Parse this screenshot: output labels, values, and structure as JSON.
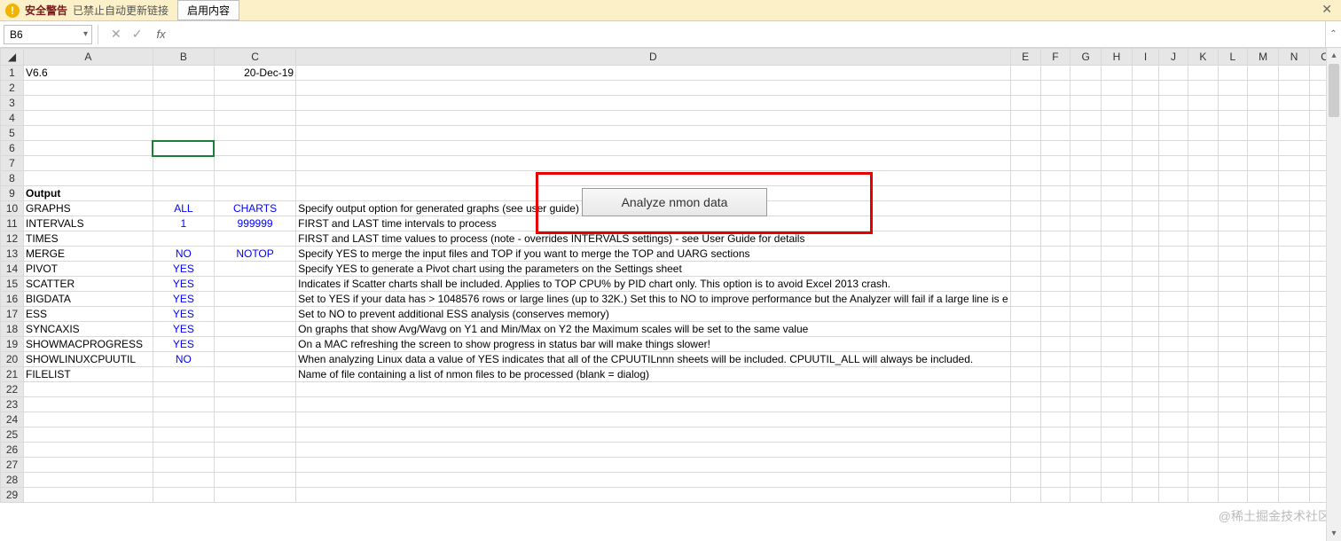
{
  "warning": {
    "title": "安全警告",
    "text": "已禁止自动更新链接",
    "button": "启用内容",
    "close": "✕"
  },
  "namebox": {
    "value": "B6"
  },
  "fb": {
    "cancel": "✕",
    "confirm": "✓",
    "fx": "fx"
  },
  "columns": [
    "A",
    "B",
    "C",
    "D",
    "E",
    "F",
    "G",
    "H",
    "I",
    "J",
    "K",
    "L",
    "M",
    "N",
    "O"
  ],
  "rows_count": 29,
  "analyze_button": "Analyze nmon data",
  "cells": {
    "A1": "V6.6",
    "C1_right": "20-Dec-19",
    "A9_bold": "Output",
    "r10": {
      "a": "GRAPHS",
      "b": "ALL",
      "c": "CHARTS",
      "d": "Specify output option for generated graphs (see user guide)"
    },
    "r11": {
      "a": "INTERVALS",
      "b": "1",
      "c": "999999",
      "d": "FIRST and LAST time intervals to process"
    },
    "r12": {
      "a": "TIMES",
      "b": "",
      "c": "",
      "d": "FIRST and LAST time values to process (note - overrides INTERVALS settings) - see User Guide for details"
    },
    "r13": {
      "a": "MERGE",
      "b": "NO",
      "c": "NOTOP",
      "d": "Specify YES to merge the input files and TOP if you want to merge the TOP and UARG sections"
    },
    "r14": {
      "a": "PIVOT",
      "b": "YES",
      "c": "",
      "d": "Specify YES to generate a Pivot chart using the parameters on the Settings sheet"
    },
    "r15": {
      "a": "SCATTER",
      "b": "YES",
      "c": "",
      "d": "Indicates if Scatter charts shall be included.  Applies to TOP CPU% by PID chart only.  This option is to avoid Excel 2013 crash."
    },
    "r16": {
      "a": "BIGDATA",
      "b": "YES",
      "c": "",
      "d": "Set to YES if your data has > 1048576 rows or large lines (up to 32K.)  Set this to NO to improve performance but the Analyzer will fail if a large line is e"
    },
    "r17": {
      "a": "ESS",
      "b": "YES",
      "c": "",
      "d": "Set to NO to prevent additional ESS analysis (conserves memory)"
    },
    "r18": {
      "a": "SYNCAXIS",
      "b": "YES",
      "c": "",
      "d": "On graphs that show Avg/Wavg on Y1 and Min/Max on Y2 the Maximum scales will be set to the same value"
    },
    "r19": {
      "a": "SHOWMACPROGRESS",
      "b": "YES",
      "c": "",
      "d": "On a MAC refreshing the screen to show progress in status bar will make things slower!"
    },
    "r20": {
      "a": "SHOWLINUXCPUUTIL",
      "b": "NO",
      "c": "",
      "d": "When analyzing Linux data a value of YES indicates that all of the CPUUTILnnn sheets will be included.  CPUUTIL_ALL will always be included."
    },
    "r21": {
      "a": "FILELIST",
      "b": "",
      "c": "",
      "d": "Name of file containing a list of nmon files to be processed (blank = dialog)"
    }
  },
  "watermark": "@稀土掘金技术社区"
}
